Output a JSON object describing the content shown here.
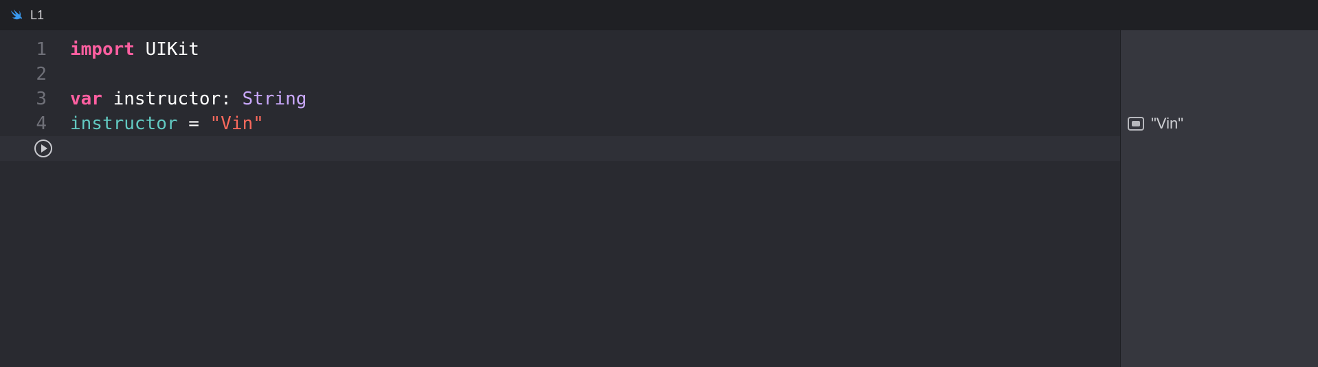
{
  "titlebar": {
    "title": "L1"
  },
  "editor": {
    "lines": [
      {
        "num": "1",
        "tokens": [
          {
            "t": "import",
            "c": "tok-keyword"
          },
          {
            "t": " ",
            "c": ""
          },
          {
            "t": "UIKit",
            "c": "tok-ident"
          }
        ]
      },
      {
        "num": "2",
        "tokens": []
      },
      {
        "num": "3",
        "tokens": [
          {
            "t": "var",
            "c": "tok-keyword"
          },
          {
            "t": " ",
            "c": ""
          },
          {
            "t": "instructor",
            "c": "tok-ident"
          },
          {
            "t": ":",
            "c": "tok-punct"
          },
          {
            "t": " ",
            "c": ""
          },
          {
            "t": "String",
            "c": "tok-type"
          }
        ]
      },
      {
        "num": "4",
        "tokens": [
          {
            "t": "instructor",
            "c": "tok-var"
          },
          {
            "t": " ",
            "c": ""
          },
          {
            "t": "=",
            "c": "tok-punct"
          },
          {
            "t": " ",
            "c": ""
          },
          {
            "t": "\"Vin\"",
            "c": "tok-string"
          }
        ]
      }
    ]
  },
  "results": {
    "items": [
      {
        "line": 4,
        "value": "\"Vin\""
      }
    ]
  }
}
